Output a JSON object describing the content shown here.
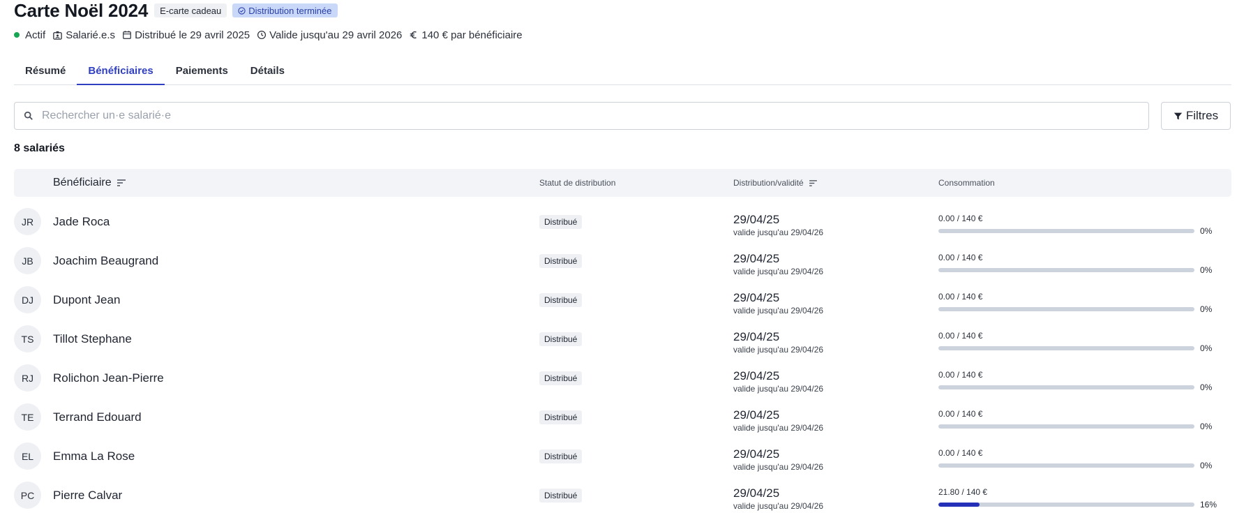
{
  "header": {
    "title": "Carte Noël 2024",
    "type_badge": "E-carte cadeau",
    "distribution_badge": "Distribution terminée",
    "status": "Actif",
    "audience": "Salarié.e.s",
    "distributed": "Distribué le 29 avril 2025",
    "valid_until": "Valide jusqu'au 29 avril 2026",
    "amount_per_beneficiary": "140 € par bénéficiaire",
    "colors": {
      "status_dot": "#1aa555",
      "accent": "#2f3fc0",
      "badge_blue_bg": "#c9d8f8"
    }
  },
  "tabs": [
    {
      "label": "Résumé",
      "active": false
    },
    {
      "label": "Bénéficiaires",
      "active": true
    },
    {
      "label": "Paiements",
      "active": false
    },
    {
      "label": "Détails",
      "active": false
    }
  ],
  "search": {
    "placeholder": "Rechercher un·e salarié·e",
    "icon": "search-icon"
  },
  "filters": {
    "label": "Filtres",
    "icon": "filter-icon"
  },
  "count_label": "8 salariés",
  "table": {
    "columns": {
      "beneficiary": "Bénéficiaire",
      "status": "Statut de distribution",
      "distribution": "Distribution/validité",
      "consumption": "Consommation"
    },
    "rows": [
      {
        "initials": "JR",
        "name": "Jade Roca",
        "status": "Distribué",
        "date": "29/04/25",
        "validity": "valide jusqu'au 29/04/26",
        "amount": "0.00 / 140 €",
        "percent_label": "0%",
        "percent": 0
      },
      {
        "initials": "JB",
        "name": "Joachim Beaugrand",
        "status": "Distribué",
        "date": "29/04/25",
        "validity": "valide jusqu'au 29/04/26",
        "amount": "0.00 / 140 €",
        "percent_label": "0%",
        "percent": 0
      },
      {
        "initials": "DJ",
        "name": "Dupont Jean",
        "status": "Distribué",
        "date": "29/04/25",
        "validity": "valide jusqu'au 29/04/26",
        "amount": "0.00 / 140 €",
        "percent_label": "0%",
        "percent": 0
      },
      {
        "initials": "TS",
        "name": "Tillot Stephane",
        "status": "Distribué",
        "date": "29/04/25",
        "validity": "valide jusqu'au 29/04/26",
        "amount": "0.00 / 140 €",
        "percent_label": "0%",
        "percent": 0
      },
      {
        "initials": "RJ",
        "name": "Rolichon Jean-Pierre",
        "status": "Distribué",
        "date": "29/04/25",
        "validity": "valide jusqu'au 29/04/26",
        "amount": "0.00 / 140 €",
        "percent_label": "0%",
        "percent": 0
      },
      {
        "initials": "TE",
        "name": "Terrand Edouard",
        "status": "Distribué",
        "date": "29/04/25",
        "validity": "valide jusqu'au 29/04/26",
        "amount": "0.00 / 140 €",
        "percent_label": "0%",
        "percent": 0
      },
      {
        "initials": "EL",
        "name": "Emma La Rose",
        "status": "Distribué",
        "date": "29/04/25",
        "validity": "valide jusqu'au 29/04/26",
        "amount": "0.00 / 140 €",
        "percent_label": "0%",
        "percent": 0
      },
      {
        "initials": "PC",
        "name": "Pierre Calvar",
        "status": "Distribué",
        "date": "29/04/25",
        "validity": "valide jusqu'au 29/04/26",
        "amount": "21.80 / 140 €",
        "percent_label": "16%",
        "percent": 16
      }
    ]
  }
}
